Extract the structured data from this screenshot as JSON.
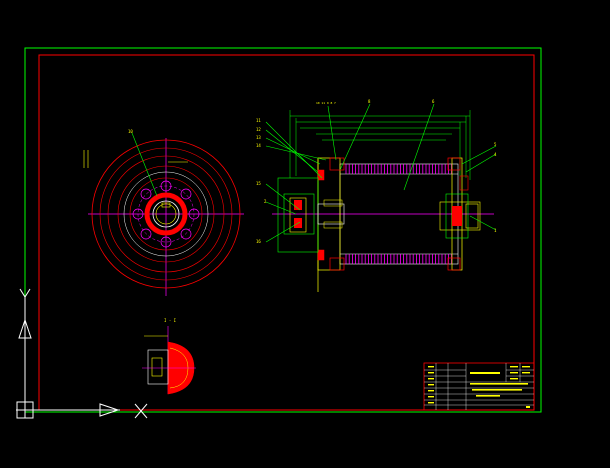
{
  "colors": {
    "background": "#000000",
    "frame_outer": "#00ff00",
    "frame_inner": "#ff0000",
    "red": "#ff0000",
    "green": "#00ff00",
    "magenta": "#ff00ff",
    "yellow": "#ffff00",
    "white": "#ffffff",
    "cyan": "#00ffff"
  },
  "drawing": {
    "part_balloons": {
      "front_view": "10",
      "top_left": "11",
      "top_mid_group": "10 11 9 8 7",
      "top_mid": "8",
      "top_right": "6",
      "right_upper_a": "5",
      "right_upper_b": "4",
      "right_lower": "1",
      "left_a": "12",
      "left_b": "13",
      "left_c": "14",
      "left_d": "15",
      "left_e": "2",
      "left_f": "3",
      "left_g": "16"
    },
    "section_label": "I - I",
    "title_block": {
      "rows": [
        "",
        "",
        "",
        "",
        "",
        "",
        ""
      ],
      "right_text": "",
      "sheet": ""
    }
  },
  "ucs": {
    "x_label": "X",
    "y_label": "Y"
  },
  "icons": {
    "ucs": "ucs-axis-icon"
  }
}
